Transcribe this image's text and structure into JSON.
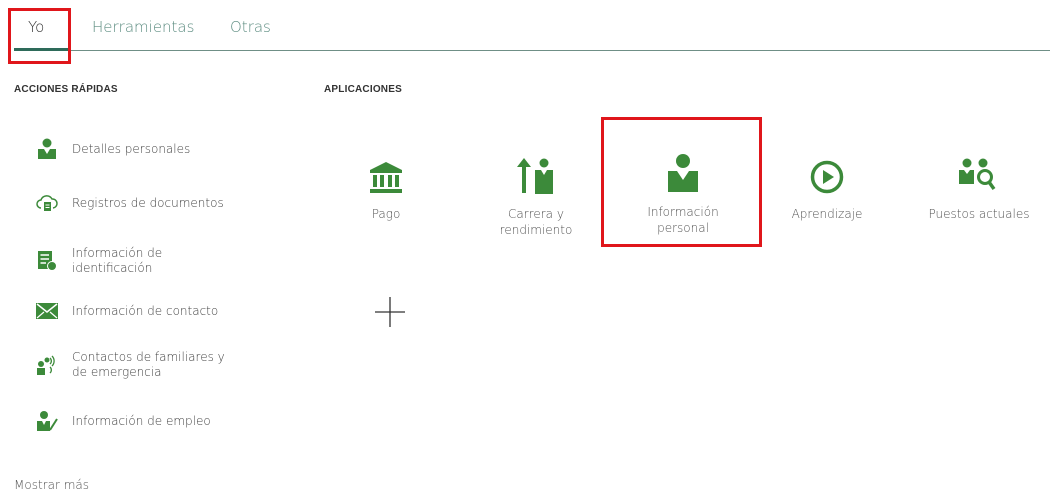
{
  "tabs": [
    {
      "label": "Yo"
    },
    {
      "label": "Herramientas"
    },
    {
      "label": "Otras"
    }
  ],
  "quick_actions": {
    "title": "ACCIONES RÁPIDAS",
    "items": [
      {
        "label": "Detalles personales",
        "icon": "person-icon"
      },
      {
        "label": "Registros de documentos",
        "icon": "cloud-document-icon"
      },
      {
        "label": "Información de identificación",
        "icon": "id-document-icon"
      },
      {
        "label": "Información de contacto",
        "icon": "envelope-icon"
      },
      {
        "label": "Contactos de familiares y de emergencia",
        "icon": "family-contacts-icon"
      },
      {
        "label": "Información de empleo",
        "icon": "person-edit-icon"
      }
    ],
    "more_label": "Mostrar más"
  },
  "applications": {
    "title": "APLICACIONES",
    "items": [
      {
        "label": "Pago",
        "icon": "bank-icon"
      },
      {
        "label": "Carrera y rendimiento",
        "icon": "career-growth-icon"
      },
      {
        "label": "Información personal",
        "icon": "person-icon"
      },
      {
        "label": "Aprendizaje",
        "icon": "play-circle-icon"
      },
      {
        "label": "Puestos actuales",
        "icon": "people-search-icon"
      }
    ],
    "add_icon": "plus-icon"
  },
  "colors": {
    "accent": "#2e7d32",
    "icon_green": "#3c8a3a",
    "highlight": "#e0161b",
    "tab_line": "#6f8f86"
  }
}
